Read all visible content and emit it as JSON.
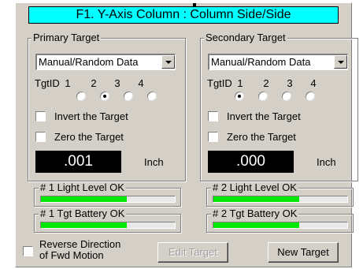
{
  "title": "F1. Y-Axis Column : Column Side/Side",
  "primary": {
    "group_label": "Primary Target",
    "select_value": "Manual/Random Data",
    "tgtid_label": "TgtID",
    "tgt_numbers": [
      "1",
      "2",
      "3",
      "4"
    ],
    "selected_tgt": "2",
    "invert_label": "Invert the Target",
    "zero_label": "Zero the Target",
    "readout": ".001",
    "unit": "Inch",
    "light_label": "# 1 Light Level OK",
    "light_level_pct": 64,
    "battery_label": "# 1 Tgt Battery OK",
    "battery_level_pct": 64
  },
  "secondary": {
    "group_label": "Secondary Target",
    "select_value": "Manual/Random Data",
    "tgtid_label": "TgtID",
    "tgt_numbers": [
      "1",
      "2",
      "3",
      "4"
    ],
    "selected_tgt": "1",
    "invert_label": "Invert the Target",
    "zero_label": "Zero the Target",
    "readout": ".000",
    "unit": "Inch",
    "light_label": "# 2 Light Level OK",
    "light_level_pct": 64,
    "battery_label": "# 2 Tgt Battery OK",
    "battery_level_pct": 64
  },
  "footer": {
    "reverse_label_line1": "Reverse Direction",
    "reverse_label_line2": "of Fwd Motion",
    "edit_button": "Edit Target",
    "new_button": "New Target"
  },
  "colors": {
    "title_bg": "#00ffff",
    "panel_bg": "#d4d0c8",
    "bar_fill": "#00e800",
    "readout_bg": "#000000"
  }
}
